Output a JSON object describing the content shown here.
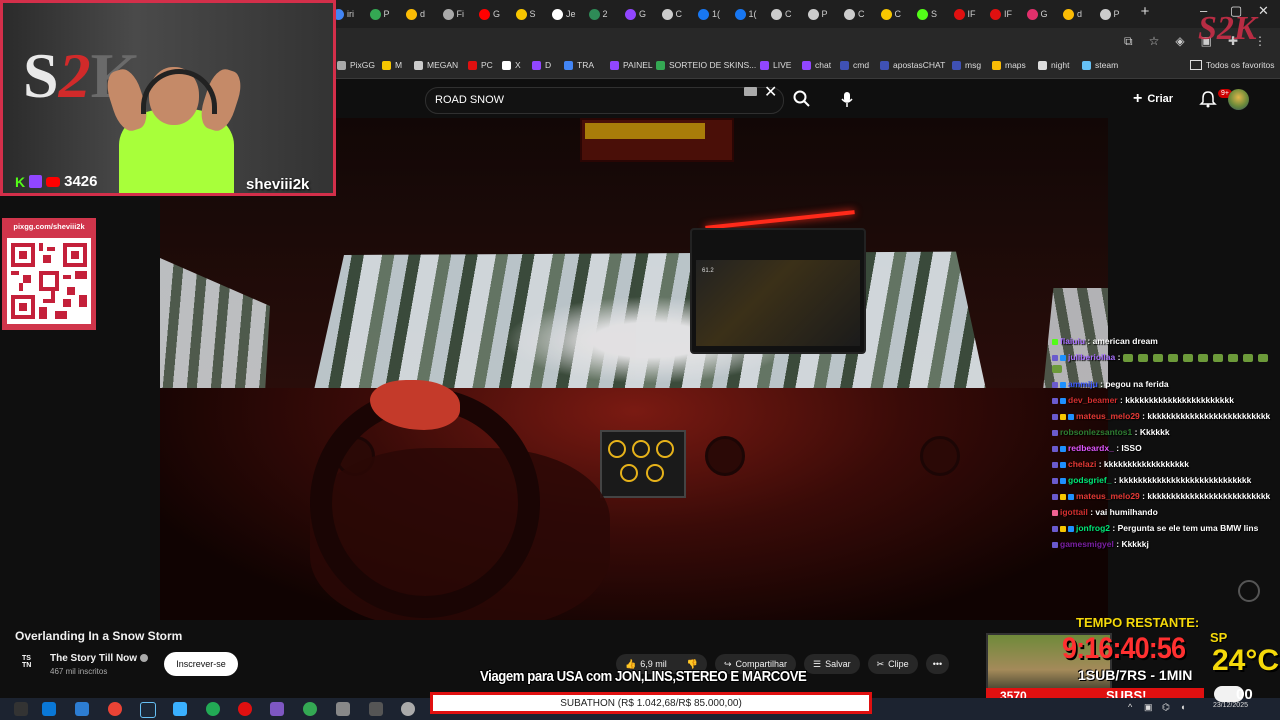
{
  "browser": {
    "tabs": [
      {
        "label": "iri",
        "color": "#4285f4"
      },
      {
        "label": "P",
        "color": "#34a853"
      },
      {
        "label": "d",
        "color": "#fbbc05"
      },
      {
        "label": "Fi",
        "color": "#aaaaaa"
      },
      {
        "label": "G",
        "color": "#ff0000"
      },
      {
        "label": "S",
        "color": "#f7c600"
      },
      {
        "label": "Je",
        "color": "#ffffff"
      },
      {
        "label": "2",
        "color": "#2e8b57"
      },
      {
        "label": "G",
        "color": "#9146ff"
      },
      {
        "label": "C",
        "color": "#cccccc"
      },
      {
        "label": "1(",
        "color": "#1877f2"
      },
      {
        "label": "1(",
        "color": "#1877f2"
      },
      {
        "label": "C",
        "color": "#cccccc"
      },
      {
        "label": "P",
        "color": "#cccccc"
      },
      {
        "label": "C",
        "color": "#cccccc"
      },
      {
        "label": "C",
        "color": "#f7c600"
      },
      {
        "label": "S",
        "color": "#53fc18"
      },
      {
        "label": "IF",
        "color": "#e01010"
      },
      {
        "label": "IF",
        "color": "#e01010"
      },
      {
        "label": "G",
        "color": "#e1306c"
      },
      {
        "label": "d",
        "color": "#fbbc05"
      },
      {
        "label": "P",
        "color": "#cccccc"
      }
    ],
    "bookmarks": [
      {
        "label": "PixGG",
        "color": "#aaaaaa"
      },
      {
        "label": "M",
        "color": "#f7c600"
      },
      {
        "label": "MEGAN",
        "color": "#cccccc"
      },
      {
        "label": "PC",
        "color": "#e01010"
      },
      {
        "label": "X",
        "color": "#ffffff"
      },
      {
        "label": "D",
        "color": "#9146ff"
      },
      {
        "label": "TRA",
        "color": "#4285f4"
      },
      {
        "label": "PAINEL",
        "color": "#9146ff"
      },
      {
        "label": "SORTEIO DE SKINS...",
        "color": "#34a853"
      },
      {
        "label": "LIVE",
        "color": "#9146ff"
      },
      {
        "label": "chat",
        "color": "#9146ff"
      },
      {
        "label": "cmd",
        "color": "#3f51b5"
      },
      {
        "label": "apostasCHAT",
        "color": "#3f51b5"
      },
      {
        "label": "msg",
        "color": "#3f51b5"
      },
      {
        "label": "maps",
        "color": "#fbbc05"
      },
      {
        "label": "night",
        "color": "#dddddd"
      },
      {
        "label": "steam",
        "color": "#66c0f4"
      }
    ],
    "bookmarks_all": "Todos os favoritos"
  },
  "youtube": {
    "search_query": "ROAD SNOW",
    "create_label": "Criar",
    "notif_count": "9+",
    "video_title": "Overlanding In a Snow Storm",
    "channel_logo": "TS TN",
    "channel_name": "The Story Till Now",
    "channel_subs": "467 mil inscritos",
    "subscribe_label": "Inscrever-se",
    "likes": "6,9 mil",
    "share_label": "Compartilhar",
    "save_label": "Salvar",
    "clip_label": "Clipe",
    "tablet_readout": "61.2"
  },
  "webcam": {
    "viewer_count": "3426",
    "streamer_name": "sheviii2k",
    "logo_s": "S",
    "logo_2": "2",
    "logo_k": "K"
  },
  "qr": {
    "url": "pixgg.com/sheviii2k"
  },
  "chat": [
    {
      "user": "flaiuiu",
      "msg": "american dream",
      "color": "#a970ff",
      "badges": [
        "#53fc18"
      ]
    },
    {
      "user": "juliberiollaa",
      "msg": "",
      "color": "#a970ff",
      "badges": [
        "#6a5acd",
        "#1e90ff"
      ],
      "emotes": 11
    },
    {
      "user": "ammiju",
      "msg": "pegou na ferida",
      "color": "#3d5afe",
      "badges": [
        "#6a5acd",
        "#1e90ff"
      ]
    },
    {
      "user": "dev_beamer",
      "msg": "kkkkkkkkkkkkkkkkkkkkkkk",
      "color": "#d32f2f",
      "badges": [
        "#6a5acd",
        "#1e90ff"
      ]
    },
    {
      "user": "mateus_melo29",
      "msg": "kkkkkkkkkkkkkkkkkkkkkkkkkk",
      "color": "#e53935",
      "badges": [
        "#6a5acd",
        "#f7c600",
        "#1e90ff"
      ]
    },
    {
      "user": "robsonlezsantos1",
      "msg": "Kkkkkk",
      "color": "#2e7d32",
      "badges": [
        "#6a5acd"
      ]
    },
    {
      "user": "redbeardx_",
      "msg": "ISSO",
      "color": "#e056fd",
      "badges": [
        "#6a5acd",
        "#1e90ff"
      ]
    },
    {
      "user": "chelazi",
      "msg": "kkkkkkkkkkkkkkkkkk",
      "color": "#e53935",
      "badges": [
        "#6a5acd",
        "#1e90ff"
      ]
    },
    {
      "user": "godsgrief_",
      "msg": "kkkkkkkkkkkkkkkkkkkkkkkkkkkk",
      "color": "#00e676",
      "badges": [
        "#6a5acd",
        "#1e90ff"
      ]
    },
    {
      "user": "mateus_melo29",
      "msg": "kkkkkkkkkkkkkkkkkkkkkkkkkk",
      "color": "#e53935",
      "badges": [
        "#6a5acd",
        "#f7c600",
        "#1e90ff"
      ]
    },
    {
      "user": "igottail",
      "msg": "vai humilhando",
      "color": "#d32f2f",
      "badges": [
        "#f06292"
      ]
    },
    {
      "user": "jonfrog2",
      "msg": "Pergunta se ele tem uma BMW lins",
      "color": "#00e676",
      "badges": [
        "#6a5acd",
        "#f7c600",
        "#1e90ff"
      ]
    },
    {
      "user": "gamesmigyel",
      "msg": "Kkkkkj",
      "color": "#7b1fa2",
      "badges": [
        "#6a5acd"
      ]
    }
  ],
  "overlay": {
    "timer_title": "TEMPO RESTANTE:",
    "timer": "9:16:40:56",
    "ratio": "1SUB/7RS - 1MIN",
    "sub_count": "3570",
    "subs_label": "SUBS!",
    "city": "SP",
    "temperature": "24°C",
    "caption": "Viagem para USA com JON,LINS,STEREO E MARCOVE",
    "subathon": "SUBATHON (R$ 1.042,68/R$ 85.000,00)"
  },
  "taskbar": {
    "date": "23/12/2025",
    "temp": "00"
  }
}
